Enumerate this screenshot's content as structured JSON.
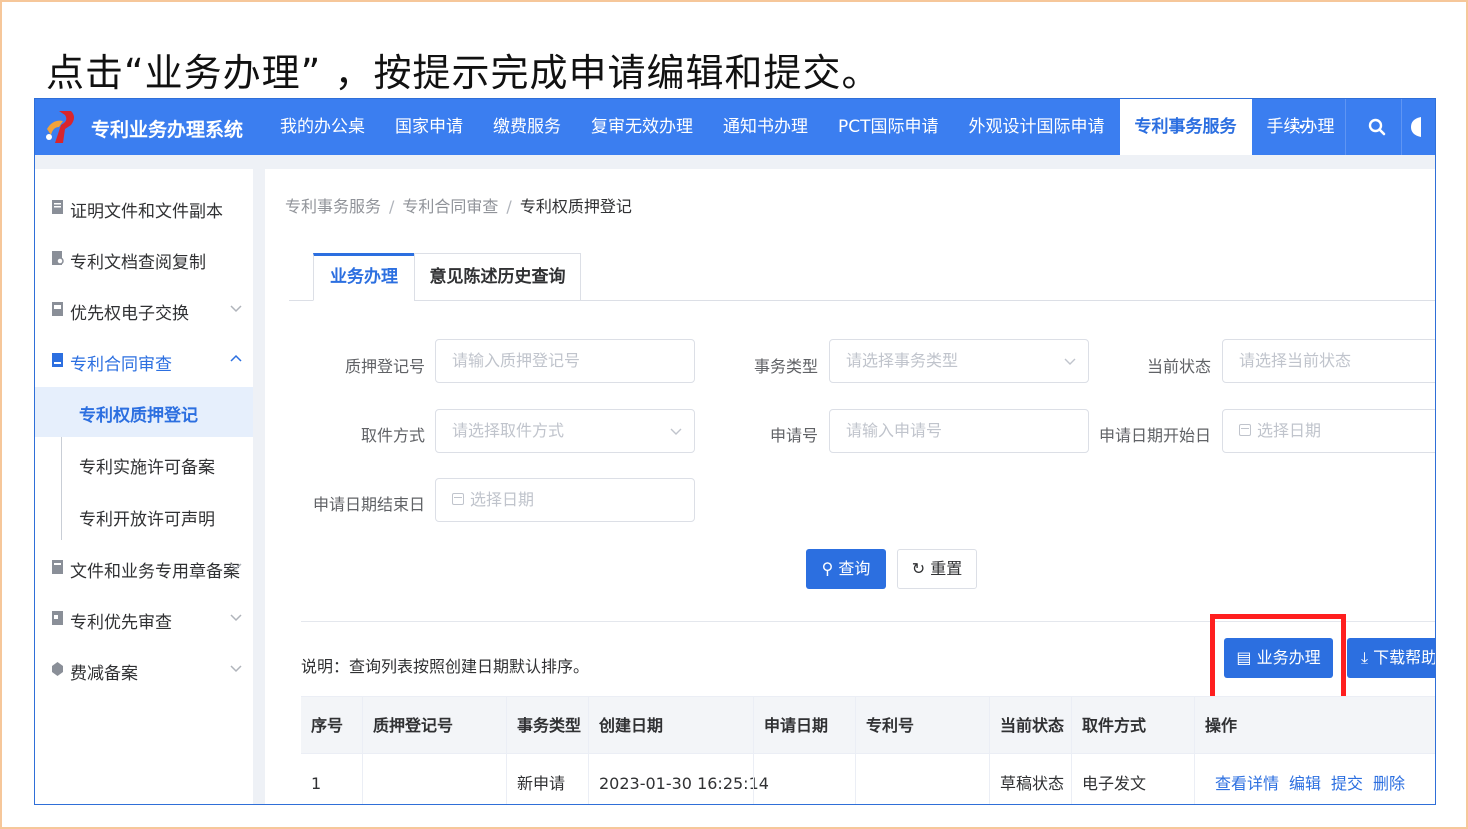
{
  "slide": {
    "title": "点击“业务办理” ，按提示完成申请编辑和提交。"
  },
  "header": {
    "app_name": "专利业务办理系统",
    "nav": [
      "我的办公桌",
      "国家申请",
      "缴费服务",
      "复审无效办理",
      "通知书办理",
      "PCT国际申请",
      "外观设计国际申请",
      "专利事务服务",
      "手续办理"
    ],
    "active_nav": "专利事务服务",
    "more": "···"
  },
  "sidebar": {
    "items": [
      {
        "label": "证明文件和文件副本",
        "icon": "document-icon"
      },
      {
        "label": "专利文档查阅复制",
        "icon": "document-search-icon"
      },
      {
        "label": "优先权电子交换",
        "icon": "exchange-icon"
      },
      {
        "label": "专利合同审查",
        "icon": "contract-icon"
      },
      {
        "label": "文件和业务专用章备案",
        "icon": "stamp-icon"
      },
      {
        "label": "专利优先审查",
        "icon": "priority-icon"
      },
      {
        "label": "费减备案",
        "icon": "fee-icon"
      }
    ],
    "sub_items": [
      "专利权质押登记",
      "专利实施许可备案",
      "专利开放许可声明"
    ]
  },
  "breadcrumb": [
    "专利事务服务",
    "专利合同审查",
    "专利权质押登记"
  ],
  "breadcrumb_sep": "/",
  "tabs": [
    "业务办理",
    "意见陈述历史查询"
  ],
  "form": {
    "pledge_no": {
      "label": "质押登记号",
      "placeholder": "请输入质押登记号"
    },
    "affair_type": {
      "label": "事务类型",
      "placeholder": "请选择事务类型"
    },
    "status": {
      "label": "当前状态",
      "placeholder": "请选择当前状态"
    },
    "pickup": {
      "label": "取件方式",
      "placeholder": "请选择取件方式"
    },
    "app_no": {
      "label": "申请号",
      "placeholder": "请输入申请号"
    },
    "start_date": {
      "label": "申请日期开始日",
      "placeholder": "选择日期"
    },
    "end_date": {
      "label": "申请日期结束日",
      "placeholder": "选择日期"
    }
  },
  "buttons": {
    "query": "查询",
    "reset": "重置",
    "business": "业务办理",
    "download": "下载帮助"
  },
  "note": "说明：查询列表按照创建日期默认排序。",
  "table": {
    "headers": [
      "序号",
      "质押登记号",
      "事务类型",
      "创建日期",
      "申请日期",
      "专利号",
      "当前状态",
      "取件方式",
      "操作"
    ],
    "rows": [
      {
        "index": "1",
        "pledge_no": "",
        "type": "新申请",
        "created": "2023-01-30 16:25:14",
        "app_date": "",
        "patent_no": "",
        "status": "草稿状态",
        "pickup": "电子发文",
        "actions": [
          "查看详情",
          "编辑",
          "提交",
          "删除"
        ]
      }
    ]
  },
  "colors": {
    "primary": "#2c6fe0",
    "header": "#3b7ef0",
    "highlight": "#ff1f1f"
  }
}
